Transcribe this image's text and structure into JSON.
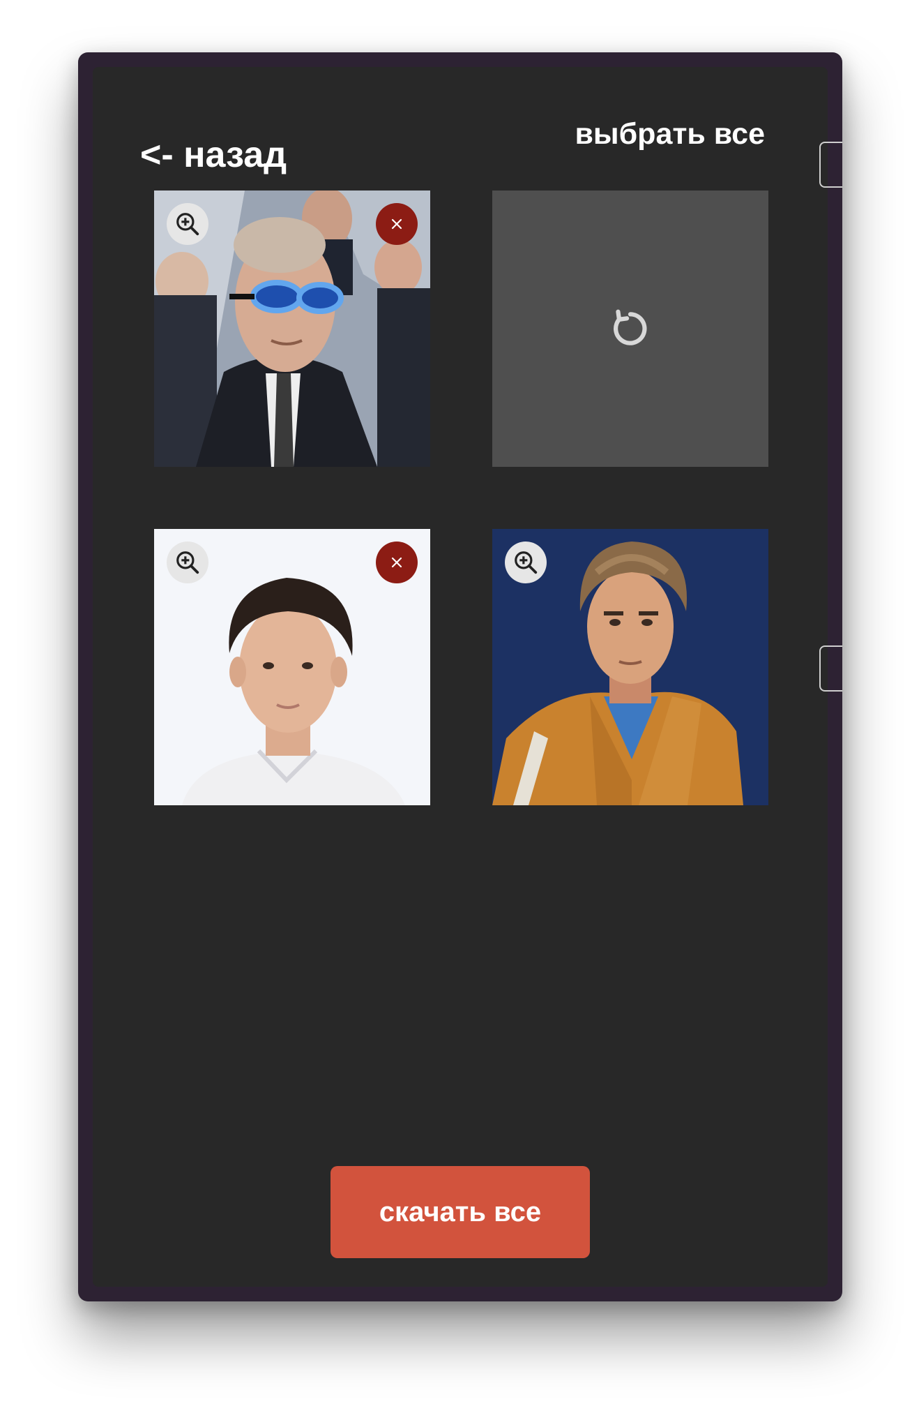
{
  "header": {
    "back_label": "<- назад",
    "select_all_label": "выбрать все"
  },
  "images": [
    {
      "state": "loaded",
      "subject": "man in suit with blue oval sunglasses",
      "zoom_icon": "zoom-in-icon",
      "remove_icon": "close-icon"
    },
    {
      "state": "loading",
      "loading_icon": "refresh-icon"
    },
    {
      "state": "loaded",
      "subject": "young man with dark hair in white shirt",
      "zoom_icon": "zoom-in-icon",
      "remove_icon": "close-icon"
    },
    {
      "state": "loaded",
      "subject": "illustrated young man in orange jacket",
      "zoom_icon": "zoom-in-icon"
    }
  ],
  "footer": {
    "download_all_label": "скачать все"
  },
  "colors": {
    "frame": "#2d2233",
    "panel": "#282828",
    "loading_tile": "#4f4f4f",
    "remove_button": "#8c1c14",
    "zoom_button": "#e6e6e6",
    "accent": "#d2533d",
    "text": "#ffffff"
  }
}
